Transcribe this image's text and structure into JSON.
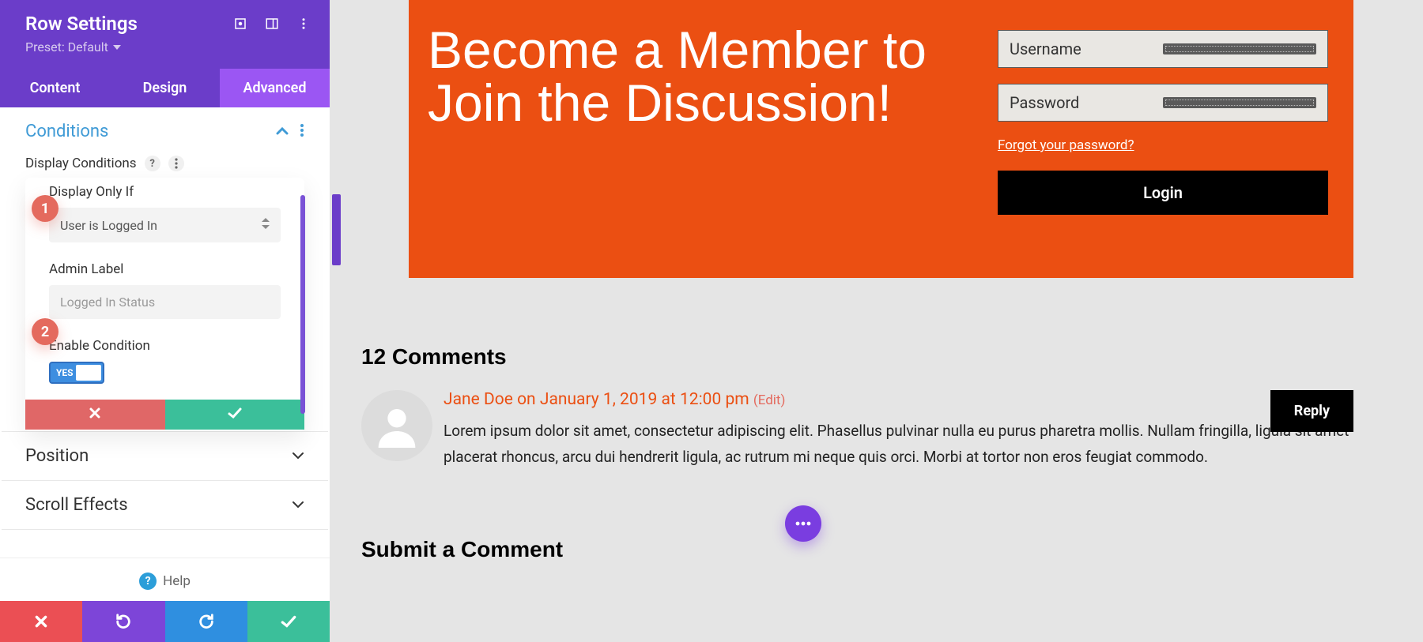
{
  "panel": {
    "title": "Row Settings",
    "preset": "Preset: Default",
    "tabs": [
      "Content",
      "Design",
      "Advanced"
    ],
    "active_tab": 2
  },
  "sections": {
    "conditions": {
      "title": "Conditions",
      "display_conditions_label": "Display Conditions",
      "display_only_if_label": "Display Only If",
      "display_only_if_value": "User is Logged In",
      "admin_label_label": "Admin Label",
      "admin_label_value": "Logged In Status",
      "enable_condition_label": "Enable Condition",
      "enable_condition_value": "YES"
    },
    "position": {
      "title": "Position"
    },
    "scroll_effects": {
      "title": "Scroll Effects"
    }
  },
  "badges": [
    "1",
    "2"
  ],
  "help_label": "Help",
  "preview": {
    "hero_title": "Become a Member to Join the Discussion!",
    "login": {
      "username_ph": "Username",
      "password_ph": "Password",
      "forgot": "Forgot your password?",
      "button": "Login"
    },
    "comments": {
      "heading": "12 Comments",
      "author": "Jane Doe",
      "meta_rest": " on January 1, 2019 at 12:00 pm ",
      "edit": "(Edit)",
      "body": "Lorem ipsum dolor sit amet, consectetur adipiscing elit. Phasellus pulvinar nulla eu purus pharetra mollis. Nullam fringilla, ligula sit amet placerat rhoncus, arcu dui hendrerit ligula, ac rutrum mi neque quis orci. Morbi at tortor non eros feugiat commodo.",
      "reply": "Reply",
      "submit_heading": "Submit a Comment"
    }
  },
  "colors": {
    "primary": "#6b3dc9",
    "accent": "#eb4f12"
  }
}
